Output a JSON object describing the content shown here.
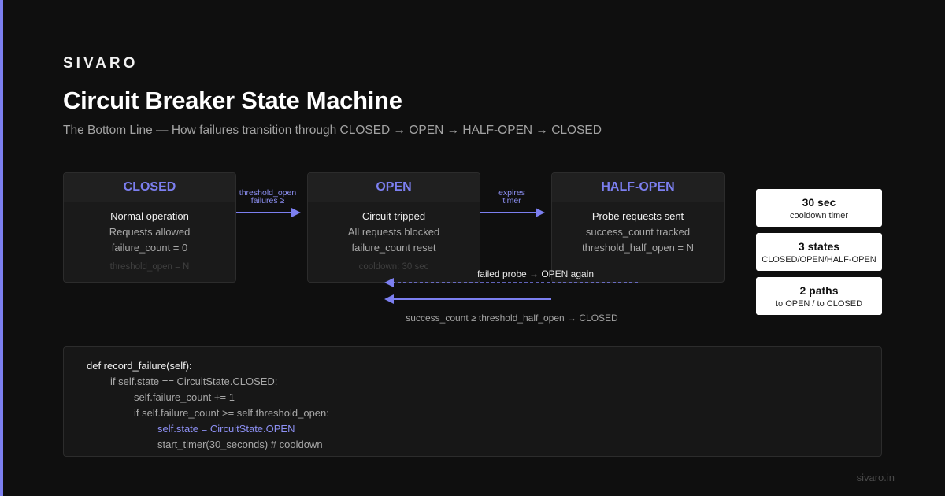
{
  "brand": "SIVARO",
  "title": "Circuit Breaker State Machine",
  "subtitle": "The Bottom Line — How failures transition through CLOSED → OPEN → HALF-OPEN → CLOSED",
  "states": [
    {
      "name": "CLOSED",
      "lines": [
        "Normal operation",
        "Requests allowed",
        "failure_count = 0",
        "threshold_open = N"
      ]
    },
    {
      "name": "OPEN",
      "lines": [
        "Circuit tripped",
        "All requests blocked",
        "failure_count reset",
        "cooldown: 30 sec"
      ]
    },
    {
      "name": "HALF-OPEN",
      "lines": [
        "Probe requests sent",
        "success_count tracked",
        "threshold_half_open = N",
        ""
      ]
    }
  ],
  "transitions": {
    "closed_to_open": [
      "threshold_open",
      "failures ≥"
    ],
    "open_to_half": [
      "expires",
      "timer"
    ],
    "half_to_open": "failed probe → OPEN again",
    "half_to_closed": "success_count ≥ threshold_half_open → CLOSED"
  },
  "stats": [
    {
      "value": "30 sec",
      "label": "cooldown timer"
    },
    {
      "value": "3 states",
      "label": "CLOSED/OPEN/HALF-OPEN"
    },
    {
      "value": "2 paths",
      "label": "to OPEN / to CLOSED"
    }
  ],
  "code": [
    "def record_failure(self):",
    "if self.state == CircuitState.CLOSED:",
    "self.failure_count += 1",
    "if self.failure_count >= self.threshold_open:",
    "self.state = CircuitState.OPEN",
    "start_timer(30_seconds) # cooldown"
  ],
  "footer": "sivaro.in",
  "colors": {
    "accent": "#7c7ff0",
    "background": "#0f0f0f",
    "panel": "#1a1a1a"
  }
}
